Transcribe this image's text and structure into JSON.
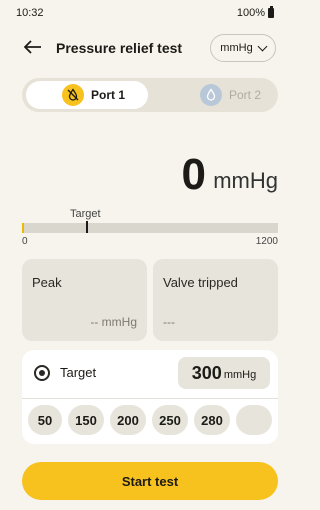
{
  "status_bar": {
    "time": "10:32",
    "battery": "100%"
  },
  "header": {
    "title": "Pressure relief test",
    "unit_selector": "mmHg"
  },
  "ports": [
    {
      "label": "Port 1",
      "selected": true
    },
    {
      "label": "Port 2",
      "selected": false
    }
  ],
  "reading": {
    "value": "0",
    "unit": "mmHg"
  },
  "gauge": {
    "target_label": "Target",
    "min": "0",
    "max": "1200",
    "target_value": 300
  },
  "peak": {
    "title": "Peak",
    "value": "-- mmHg"
  },
  "valve": {
    "title": "Valve tripped",
    "value": "---"
  },
  "target": {
    "label": "Target",
    "value": "300",
    "unit": "mmHg"
  },
  "presets": [
    "50",
    "150",
    "200",
    "250",
    "280",
    ""
  ],
  "start_button": "Start test",
  "colors": {
    "accent": "#f7c21e",
    "background": "#f6f4ec",
    "card": "#e7e4dc"
  }
}
